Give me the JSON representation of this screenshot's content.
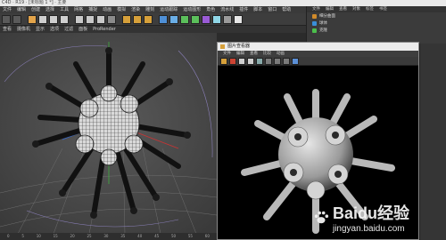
{
  "app": {
    "title": "C4D · R19 · [未标题 1 *] · 主要"
  },
  "menubar": [
    "文件",
    "编辑",
    "创建",
    "选择",
    "工具",
    "网格",
    "捕捉",
    "动画",
    "模拟",
    "渲染",
    "雕刻",
    "运动跟踪",
    "运动图形",
    "角色",
    "流水线",
    "插件",
    "脚本",
    "窗口",
    "帮助"
  ],
  "viewport_menu": [
    "查看",
    "摄像机",
    "显示",
    "选项",
    "过滤",
    "面板",
    "ProRender"
  ],
  "object_manager": {
    "menu": [
      "文件",
      "编辑",
      "查看",
      "对象",
      "标签",
      "书签"
    ],
    "objects": [
      {
        "label": "细分曲面",
        "color": "#d08a2a"
      },
      {
        "label": "球体",
        "color": "#3a8fd8"
      },
      {
        "label": "克隆",
        "color": "#4cbf4c"
      }
    ]
  },
  "render_window": {
    "title": "图片查看器",
    "menu": [
      "文件",
      "编辑",
      "查看",
      "比较",
      "动画"
    ]
  },
  "timeline": {
    "ticks": [
      "0",
      "5",
      "10",
      "15",
      "20",
      "25",
      "30",
      "35",
      "40",
      "45",
      "50",
      "55",
      "60"
    ]
  },
  "watermark": {
    "brand": "Baidu经验",
    "url": "jingyan.baidu.com"
  },
  "colors": {
    "accent": "#e3a44a",
    "viewport_bg": "#454545",
    "render_bg": "#000000"
  }
}
